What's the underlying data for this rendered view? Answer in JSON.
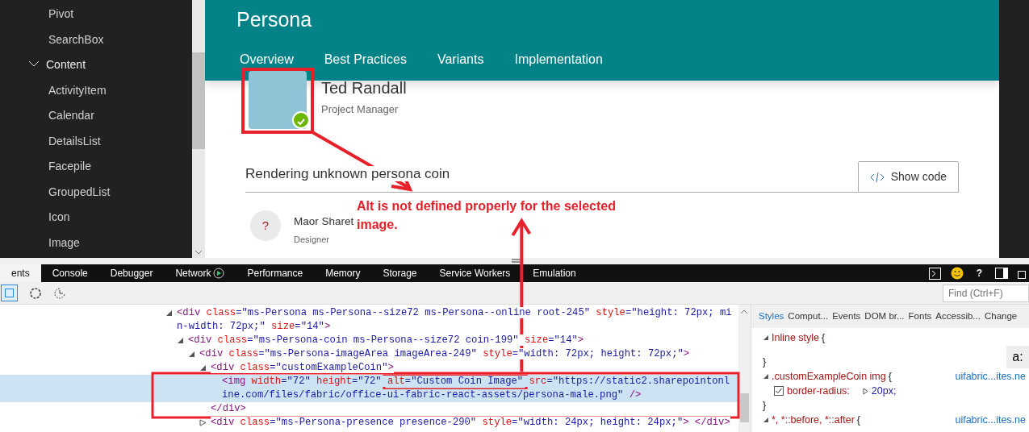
{
  "sidebar": {
    "items": [
      {
        "kind": "item",
        "label": "Pivot"
      },
      {
        "kind": "item",
        "label": "SearchBox"
      },
      {
        "kind": "group",
        "label": "Content",
        "expanded": true
      },
      {
        "kind": "item",
        "label": "ActivityItem"
      },
      {
        "kind": "item",
        "label": "Calendar"
      },
      {
        "kind": "item",
        "label": "DetailsList"
      },
      {
        "kind": "item",
        "label": "Facepile"
      },
      {
        "kind": "item",
        "label": "GroupedList"
      },
      {
        "kind": "item",
        "label": "Icon"
      },
      {
        "kind": "item",
        "label": "Image"
      }
    ]
  },
  "page": {
    "title": "Persona",
    "tabs": [
      "Overview",
      "Best Practices",
      "Variants",
      "Implementation"
    ],
    "persona": {
      "name": "Ted Randall",
      "role": "Project Manager",
      "online": true
    },
    "section": {
      "title": "Rendering unknown persona coin",
      "button": "Show code"
    },
    "persona2": {
      "initials": "?",
      "name": "Maor Sharet",
      "role": "Designer"
    }
  },
  "annotation": {
    "note": "Alt is not defined properly for the selected image."
  },
  "devtools": {
    "tabs": [
      {
        "label": "ents",
        "selected": true,
        "recording": false
      },
      {
        "label": "Console",
        "selected": false,
        "recording": false
      },
      {
        "label": "Debugger",
        "selected": false,
        "recording": false
      },
      {
        "label": "Network",
        "selected": false,
        "recording": true
      },
      {
        "label": "Performance",
        "selected": false,
        "recording": false
      },
      {
        "label": "Memory",
        "selected": false,
        "recording": false
      },
      {
        "label": "Storage",
        "selected": false,
        "recording": false
      },
      {
        "label": "Service Workers",
        "selected": false,
        "recording": false
      },
      {
        "label": "Emulation",
        "selected": false,
        "recording": false
      }
    ],
    "help": "?",
    "find_placeholder": "Find (Ctrl+F)",
    "dom": [
      {
        "text": "<div class=\"ms-Persona ms-Persona--size72 ms-Persona--online root-245\" style=\"height: 72px; min-width: 72px;\" size=\"14\">",
        "expanded": true,
        "selected": false,
        "children": [
          {
            "text": "<div class=\"ms-Persona-coin ms-Persona--size72 coin-199\" size=\"14\">",
            "expanded": true,
            "selected": false,
            "children": [
              {
                "text": "<div class=\"ms-Persona-imageArea imageArea-249\" style=\"width: 72px; height: 72px;\">",
                "expanded": true,
                "selected": false,
                "children": [
                  {
                    "text": "<div class=\"customExampleCoin\">",
                    "expanded": true,
                    "selected": false,
                    "close": "</div>",
                    "children": [
                      {
                        "text": "<img width=\"72\" height=\"72\" alt=\"Custom Coin Image\" src=\"https://static2.sharepointonline.com/files/fabric/office-ui-fabric-react-assets/persona-male.png\" />",
                        "selected": true
                      }
                    ]
                  },
                  {
                    "text": "<div class=\"ms-Persona-presence presence-290\" style=\"width: 24px; height: 24px;\"> </div>",
                    "expanded": false,
                    "selected": false
                  }
                ]
              }
            ]
          }
        ]
      }
    ],
    "styles_tabs": [
      {
        "label": "Styles",
        "selected": true
      },
      {
        "label": "Comput...",
        "selected": false
      },
      {
        "label": "Events",
        "selected": false
      },
      {
        "label": "DOM br...",
        "selected": false
      },
      {
        "label": "Fonts",
        "selected": false
      },
      {
        "label": "Accessib...",
        "selected": false
      },
      {
        "label": "Change",
        "selected": false
      }
    ],
    "pseudo_button": "a:",
    "rules": [
      {
        "selector": "Inline style",
        "open": "{",
        "close": "}"
      },
      {
        "selector": ".customExampleCoin img",
        "open": "{",
        "close": "}",
        "source": "uifabric...ites.ne",
        "props": [
          {
            "name": "border-radius:",
            "value": "20px;",
            "checked": true
          }
        ]
      },
      {
        "selector": "*, *::before, *::after",
        "open": "{",
        "source": "uifabric...ites.ne"
      }
    ]
  }
}
